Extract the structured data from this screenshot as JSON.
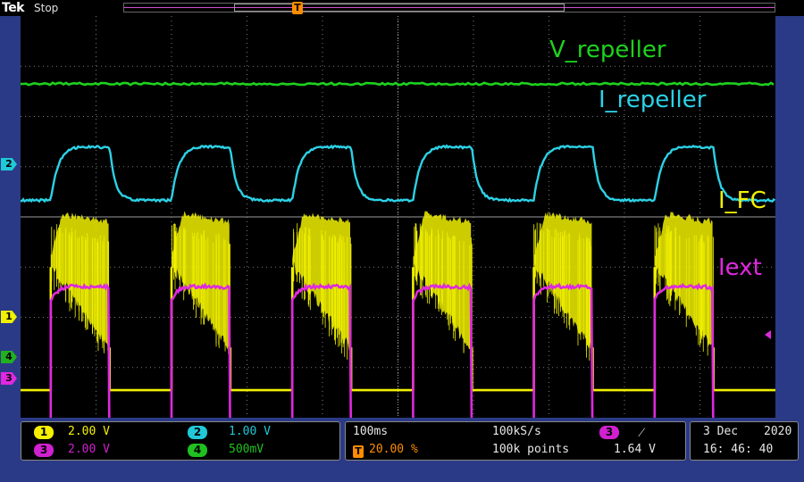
{
  "header": {
    "brand": "Tek",
    "run_state": "Stop"
  },
  "trace_labels": {
    "v_repeller": "V_repeller",
    "i_repeller": "I_repeller",
    "i_fc": "I_FC",
    "iext": "Iext"
  },
  "markers": {
    "trigger_position": "T",
    "ch1": "1",
    "ch2": "2",
    "ch3": "3",
    "ch4": "4"
  },
  "channels": [
    {
      "num": "1",
      "scale": "2.00 V",
      "color": "#f5f000"
    },
    {
      "num": "2",
      "scale": "1.00 V",
      "color": "#20c8d8"
    },
    {
      "num": "3",
      "scale": "2.00 V",
      "color": "#e020e0"
    },
    {
      "num": "4",
      "scale": "500mV",
      "color": "#20c020"
    }
  ],
  "timebase": {
    "time_div": "100ms",
    "sample_rate": "100kS/s",
    "trigger_pos": "20.00 %",
    "record_length": "100k points"
  },
  "trigger": {
    "source": "3",
    "slope_symbol": "⁄",
    "level": "1.64 V"
  },
  "datetime": {
    "date": "3 Dec",
    "year": "2020",
    "time": "16: 46: 40"
  },
  "colors": {
    "v_repeller": "#1ed21e",
    "i_repeller": "#2cd2e6",
    "i_fc": "#f0f000",
    "iext": "#e028e0",
    "grid": "#7a7a7a",
    "background": "#000000",
    "frame": "#2b3a86",
    "trigger_marker": "#ff8c00"
  }
}
